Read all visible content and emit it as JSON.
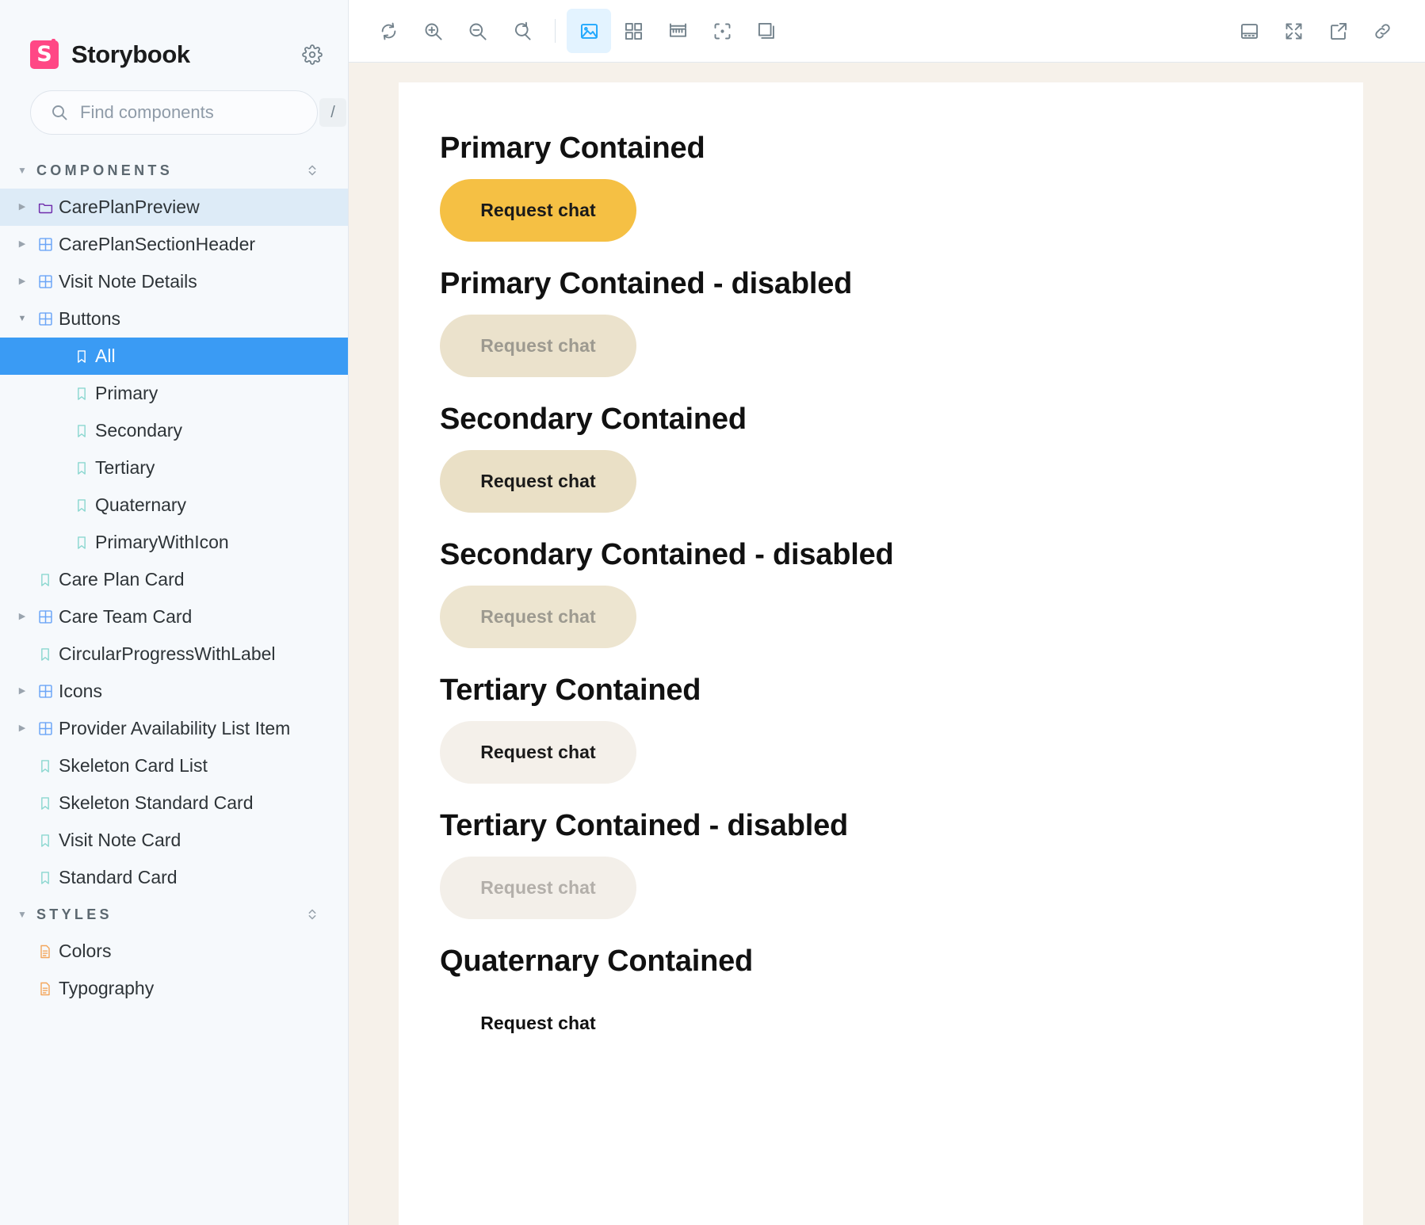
{
  "app": {
    "brand_title": "Storybook",
    "logo_letter": "S"
  },
  "search": {
    "placeholder": "Find components",
    "value": "",
    "shortcut": "/"
  },
  "sidebar": {
    "sections": [
      {
        "label": "COMPONENTS",
        "expanded": true,
        "items": [
          {
            "label": "CarePlanPreview",
            "icon": "folder-icon",
            "depth": 0,
            "arrow": "right",
            "state": "hovered"
          },
          {
            "label": "CarePlanSectionHeader",
            "icon": "component-icon",
            "depth": 0,
            "arrow": "right",
            "state": "normal"
          },
          {
            "label": "Visit Note Details",
            "icon": "component-icon",
            "depth": 0,
            "arrow": "right",
            "state": "normal"
          },
          {
            "label": "Buttons",
            "icon": "component-icon",
            "depth": 0,
            "arrow": "down",
            "state": "normal"
          },
          {
            "label": "All",
            "icon": "story-icon",
            "depth": 2,
            "arrow": "none",
            "state": "selected"
          },
          {
            "label": "Primary",
            "icon": "story-icon",
            "depth": 2,
            "arrow": "none",
            "state": "normal"
          },
          {
            "label": "Secondary",
            "icon": "story-icon",
            "depth": 2,
            "arrow": "none",
            "state": "normal"
          },
          {
            "label": "Tertiary",
            "icon": "story-icon",
            "depth": 2,
            "arrow": "none",
            "state": "normal"
          },
          {
            "label": "Quaternary",
            "icon": "story-icon",
            "depth": 2,
            "arrow": "none",
            "state": "normal"
          },
          {
            "label": "PrimaryWithIcon",
            "icon": "story-icon",
            "depth": 2,
            "arrow": "none",
            "state": "normal"
          },
          {
            "label": "Care Plan Card",
            "icon": "story-icon",
            "depth": 1,
            "arrow": "none",
            "state": "normal"
          },
          {
            "label": "Care Team Card",
            "icon": "component-icon",
            "depth": 0,
            "arrow": "right",
            "state": "normal"
          },
          {
            "label": "CircularProgressWithLabel",
            "icon": "story-icon",
            "depth": 1,
            "arrow": "none",
            "state": "normal"
          },
          {
            "label": "Icons",
            "icon": "component-icon",
            "depth": 0,
            "arrow": "right",
            "state": "normal"
          },
          {
            "label": "Provider Availability List Item",
            "icon": "component-icon",
            "depth": 0,
            "arrow": "right",
            "state": "normal"
          },
          {
            "label": "Skeleton Card List",
            "icon": "story-icon",
            "depth": 1,
            "arrow": "none",
            "state": "normal"
          },
          {
            "label": "Skeleton Standard Card",
            "icon": "story-icon",
            "depth": 1,
            "arrow": "none",
            "state": "normal"
          },
          {
            "label": "Visit Note Card",
            "icon": "story-icon",
            "depth": 1,
            "arrow": "none",
            "state": "normal"
          },
          {
            "label": "Standard Card",
            "icon": "story-icon",
            "depth": 1,
            "arrow": "none",
            "state": "normal"
          }
        ]
      },
      {
        "label": "STYLES",
        "expanded": true,
        "items": [
          {
            "label": "Colors",
            "icon": "document-icon",
            "depth": 1,
            "arrow": "none",
            "state": "normal"
          },
          {
            "label": "Typography",
            "icon": "document-icon",
            "depth": 1,
            "arrow": "none",
            "state": "normal"
          }
        ]
      }
    ]
  },
  "toolbar": {
    "left": [
      {
        "name": "remount-icon",
        "title": "Remount component",
        "active": false
      },
      {
        "name": "zoom-in-icon",
        "title": "Zoom in",
        "active": false
      },
      {
        "name": "zoom-out-icon",
        "title": "Zoom out",
        "active": false
      },
      {
        "name": "zoom-reset-icon",
        "title": "Reset zoom",
        "active": false
      },
      {
        "name": "separator",
        "title": "",
        "active": false
      },
      {
        "name": "backgrounds-icon",
        "title": "Change background",
        "active": true
      },
      {
        "name": "grid-icon",
        "title": "Apply a grid",
        "active": false
      },
      {
        "name": "measure-icon",
        "title": "Enable measure",
        "active": false
      },
      {
        "name": "outline-icon",
        "title": "Apply outlines",
        "active": false
      },
      {
        "name": "layers-icon",
        "title": "Go full screen",
        "active": false
      }
    ],
    "right": [
      {
        "name": "addons-panel-icon",
        "title": "Change addon orientation",
        "active": false
      },
      {
        "name": "fullscreen-icon",
        "title": "Go full screen",
        "active": false
      },
      {
        "name": "open-new-tab-icon",
        "title": "Open canvas in new tab",
        "active": false
      },
      {
        "name": "copy-link-icon",
        "title": "Copy canvas link",
        "active": false
      }
    ]
  },
  "preview": {
    "button_label": "Request chat",
    "stories": [
      {
        "heading": "Primary Contained",
        "variant": "primary",
        "disabled": false
      },
      {
        "heading": "Primary Contained - disabled",
        "variant": "primary-d",
        "disabled": true
      },
      {
        "heading": "Secondary Contained",
        "variant": "secondary",
        "disabled": false
      },
      {
        "heading": "Secondary Contained - disabled",
        "variant": "secondary-d",
        "disabled": true
      },
      {
        "heading": "Tertiary Contained",
        "variant": "tertiary",
        "disabled": false
      },
      {
        "heading": "Tertiary Contained - disabled",
        "variant": "tertiary-d",
        "disabled": true
      },
      {
        "heading": "Quaternary Contained",
        "variant": "quaternary",
        "disabled": false
      }
    ]
  },
  "colors": {
    "brand_pink": "#FF4785",
    "selection_blue": "#3A9BF4",
    "hover_blue": "#DDEBF7",
    "accent_blue": "#1EA7FD",
    "sidebar_bg": "#F6F9FC",
    "preview_bg": "#F6F1EA",
    "primary_button": "#F5C044",
    "secondary_button": "#EAE0C6",
    "tertiary_button": "#F4F0EA"
  }
}
